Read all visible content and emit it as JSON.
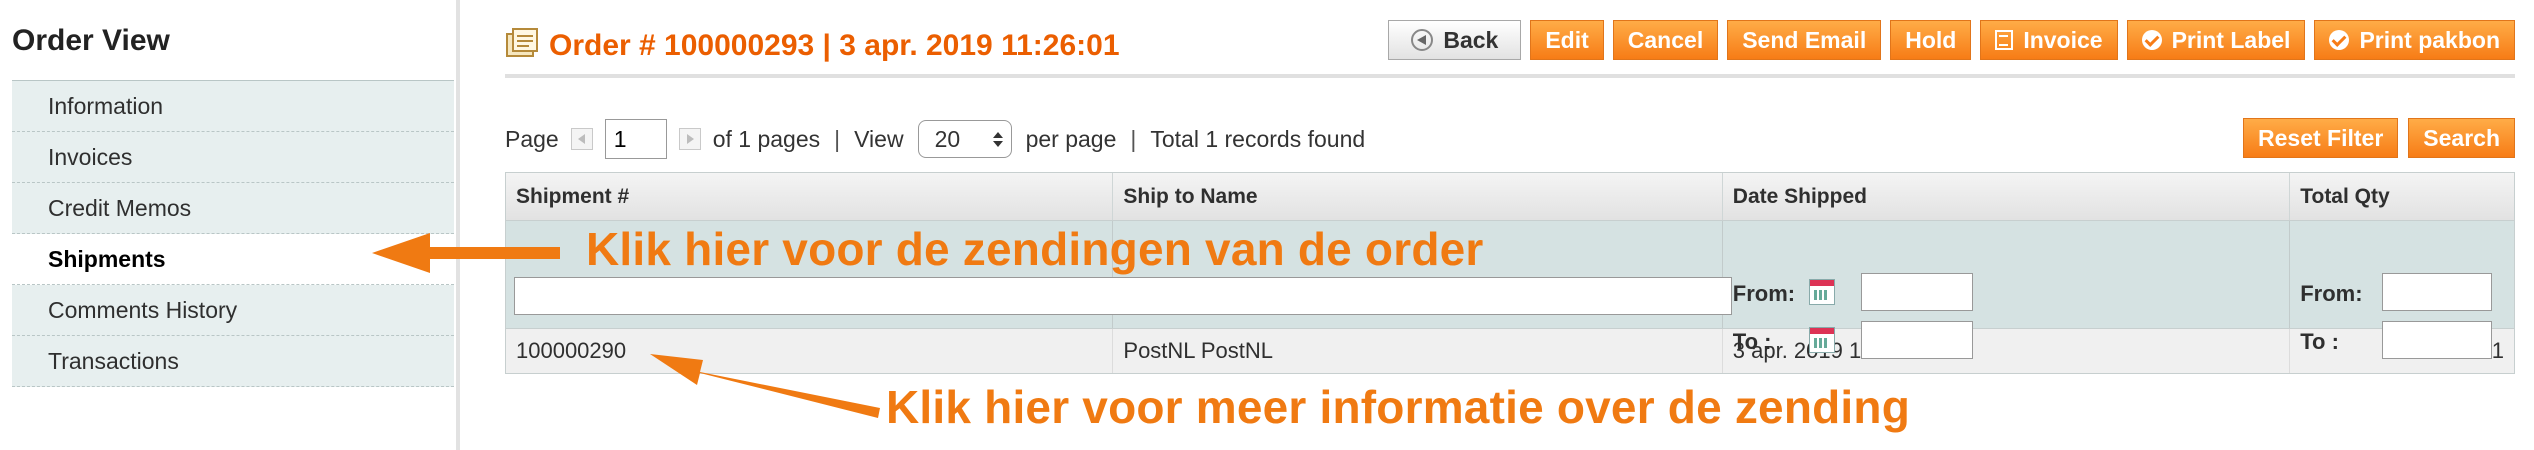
{
  "sidebar": {
    "title": "Order View",
    "items": [
      {
        "label": "Information",
        "active": false
      },
      {
        "label": "Invoices",
        "active": false
      },
      {
        "label": "Credit Memos",
        "active": false
      },
      {
        "label": "Shipments",
        "active": true
      },
      {
        "label": "Comments History",
        "active": false
      },
      {
        "label": "Transactions",
        "active": false
      }
    ]
  },
  "header": {
    "title": "Order # 100000293 | 3 apr. 2019 11:26:01",
    "icon": "order-page-icon",
    "buttons": {
      "back": "Back",
      "edit": "Edit",
      "cancel": "Cancel",
      "send_email": "Send Email",
      "hold": "Hold",
      "invoice": "Invoice",
      "print_label": "Print Label",
      "print_pakbon": "Print pakbon"
    }
  },
  "pager": {
    "page_label": "Page",
    "page_value": "1",
    "of_pages": "of 1 pages",
    "separator": "|",
    "view_label": "View",
    "view_value": "20",
    "per_page": "per page",
    "total": "Total 1 records found"
  },
  "filters": {
    "reset": "Reset Filter",
    "search": "Search",
    "from": "From:",
    "to": "To :"
  },
  "grid": {
    "columns": [
      "Shipment #",
      "Ship to Name",
      "Date Shipped",
      "Total Qty"
    ],
    "rows": [
      {
        "shipment": "100000290",
        "ship_to": "PostNL PostNL",
        "date": "3 apr. 2019 11:30:39",
        "qty": "1"
      }
    ]
  },
  "annotations": {
    "shipments_hint": "Klik hier voor de zendingen van de order",
    "shipment_hint": "Klik hier voor meer informatie over de zending",
    "color": "#f07a12"
  },
  "colors": {
    "accent": "#eb5e00",
    "button": "#f77c16",
    "sidebar_bg": "#e7efef",
    "filter_bg": "#d5e2e2"
  }
}
